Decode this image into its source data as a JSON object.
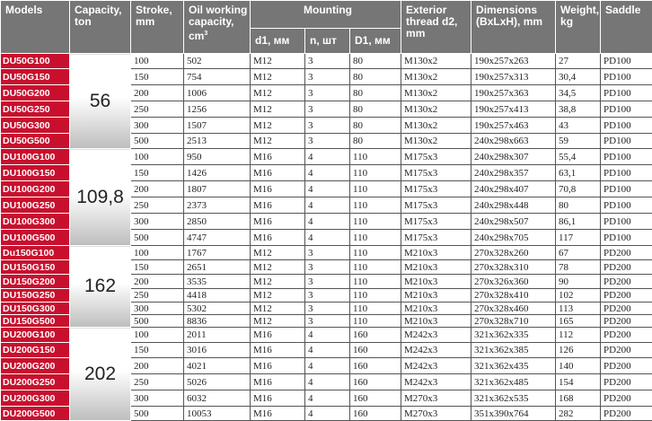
{
  "headers": {
    "models": "Models",
    "capacity": "Capacity, ton",
    "stroke": "Stroke, mm",
    "oil": "Oil working capacity, cm",
    "oil_sup": "3",
    "mounting": "Mounting",
    "d1": "d1, мм",
    "n": "n, шт",
    "D1": "D1, мм",
    "thread": "Exterior thread d2, mm",
    "dimensions": "Dimensions (BxLxH), mm",
    "weight": "Weight, kg",
    "saddle": "Saddle"
  },
  "groups": [
    {
      "capacity": "56",
      "rows": [
        {
          "model": "DU50G100",
          "stroke": "100",
          "oil": "502",
          "d1": "M12",
          "n": "3",
          "D1": "80",
          "thread": "M130x2",
          "dims": "190x257x263",
          "weight": "27",
          "saddle": "PD100"
        },
        {
          "model": "DU50G150",
          "stroke": "150",
          "oil": "754",
          "d1": "M12",
          "n": "3",
          "D1": "80",
          "thread": "M130x2",
          "dims": "190x257x313",
          "weight": "30,4",
          "saddle": "PD100"
        },
        {
          "model": "DU50G200",
          "stroke": "200",
          "oil": "1006",
          "d1": "M12",
          "n": "3",
          "D1": "80",
          "thread": "M130x2",
          "dims": "190x257x363",
          "weight": "34,5",
          "saddle": "PD100"
        },
        {
          "model": "DU50G250",
          "stroke": "250",
          "oil": "1256",
          "d1": "M12",
          "n": "3",
          "D1": "80",
          "thread": "M130x2",
          "dims": "190x257x413",
          "weight": "38,8",
          "saddle": "PD100"
        },
        {
          "model": "DU50G300",
          "stroke": "300",
          "oil": "1507",
          "d1": "M12",
          "n": "3",
          "D1": "80",
          "thread": "M130x2",
          "dims": "190x257x463",
          "weight": "43",
          "saddle": "PD100"
        },
        {
          "model": "DU50G500",
          "stroke": "500",
          "oil": "2513",
          "d1": "M12",
          "n": "3",
          "D1": "80",
          "thread": "M130x2",
          "dims": "240x298x663",
          "weight": "59",
          "saddle": "PD100"
        }
      ]
    },
    {
      "capacity": "109,8",
      "rows": [
        {
          "model": "DU100G100",
          "stroke": "100",
          "oil": "950",
          "d1": "M16",
          "n": "4",
          "D1": "110",
          "thread": "M175x3",
          "dims": "240x298x307",
          "weight": "55,4",
          "saddle": "PD100"
        },
        {
          "model": "DU100G150",
          "stroke": "150",
          "oil": "1426",
          "d1": "M16",
          "n": "4",
          "D1": "110",
          "thread": "M175x3",
          "dims": "240x298x357",
          "weight": "63,1",
          "saddle": "PD100"
        },
        {
          "model": "DU100G200",
          "stroke": "200",
          "oil": "1807",
          "d1": "M16",
          "n": "4",
          "D1": "110",
          "thread": "M175x3",
          "dims": "240x298x407",
          "weight": "70,8",
          "saddle": "PD100"
        },
        {
          "model": "DU100G250",
          "stroke": "250",
          "oil": "2373",
          "d1": "M16",
          "n": "4",
          "D1": "110",
          "thread": "M175x3",
          "dims": "240x298x448",
          "weight": "80",
          "saddle": "PD100"
        },
        {
          "model": "DU100G300",
          "stroke": "300",
          "oil": "2850",
          "d1": "M16",
          "n": "4",
          "D1": "110",
          "thread": "M175x3",
          "dims": "240x298x507",
          "weight": "86,1",
          "saddle": "PD100"
        },
        {
          "model": "DU100G500",
          "stroke": "500",
          "oil": "4747",
          "d1": "M16",
          "n": "4",
          "D1": "110",
          "thread": "M175x3",
          "dims": "240x298x705",
          "weight": "117",
          "saddle": "PD100"
        }
      ]
    },
    {
      "capacity": "162",
      "rows": [
        {
          "model": "Du150G100",
          "stroke": "100",
          "oil": "1767",
          "d1": "M12",
          "n": "3",
          "D1": "110",
          "thread": "M210x3",
          "dims": "270x328x260",
          "weight": "67",
          "saddle": "PD200"
        },
        {
          "model": "DU150G150",
          "stroke": "150",
          "oil": "2651",
          "d1": "M12",
          "n": "3",
          "D1": "110",
          "thread": "M210x3",
          "dims": "270x328x310",
          "weight": "78",
          "saddle": "PD200"
        },
        {
          "model": "DU150G200",
          "stroke": "200",
          "oil": "3535",
          "d1": "M12",
          "n": "3",
          "D1": "110",
          "thread": "M210x3",
          "dims": "270x326x360",
          "weight": "90",
          "saddle": "PD200"
        },
        {
          "model": "DU150G250",
          "stroke": "250",
          "oil": "4418",
          "d1": "M12",
          "n": "3",
          "D1": "110",
          "thread": "M210x3",
          "dims": "270x328x410",
          "weight": "102",
          "saddle": "PD200"
        },
        {
          "model": "DU150G300",
          "stroke": "300",
          "oil": "5302",
          "d1": "M12",
          "n": "3",
          "D1": "110",
          "thread": "M210x3",
          "dims": "270x328x460",
          "weight": "113",
          "saddle": "PD200"
        },
        {
          "model": "DU150G500",
          "stroke": "500",
          "oil": "8836",
          "d1": "M12",
          "n": "3",
          "D1": "110",
          "thread": "M210x3",
          "dims": "270x328x710",
          "weight": "165",
          "saddle": "PD200"
        }
      ]
    },
    {
      "capacity": "202",
      "rows": [
        {
          "model": "DU200G100",
          "stroke": "100",
          "oil": "2011",
          "d1": "M16",
          "n": "4",
          "D1": "160",
          "thread": "M242x3",
          "dims": "321x362x335",
          "weight": "112",
          "saddle": "PD200"
        },
        {
          "model": "DU200G150",
          "stroke": "150",
          "oil": "3016",
          "d1": "M16",
          "n": "4",
          "D1": "160",
          "thread": "M242x3",
          "dims": "321x362x385",
          "weight": "126",
          "saddle": "PD200"
        },
        {
          "model": "DU200G200",
          "stroke": "200",
          "oil": "4021",
          "d1": "M16",
          "n": "4",
          "D1": "160",
          "thread": "M242x3",
          "dims": "321x362x435",
          "weight": "140",
          "saddle": "PD200"
        },
        {
          "model": "DU200G250",
          "stroke": "250",
          "oil": "5026",
          "d1": "M16",
          "n": "4",
          "D1": "160",
          "thread": "M242x3",
          "dims": "321x362x485",
          "weight": "154",
          "saddle": "PD200"
        },
        {
          "model": "DU200G300",
          "stroke": "300",
          "oil": "6032",
          "d1": "M16",
          "n": "4",
          "D1": "160",
          "thread": "M270x3",
          "dims": "321x362x535",
          "weight": "168",
          "saddle": "PD200"
        },
        {
          "model": "DU200G500",
          "stroke": "500",
          "oil": "10053",
          "d1": "M16",
          "n": "4",
          "D1": "160",
          "thread": "M270x3",
          "dims": "351x390x764",
          "weight": "282",
          "saddle": "PD200"
        }
      ]
    }
  ]
}
